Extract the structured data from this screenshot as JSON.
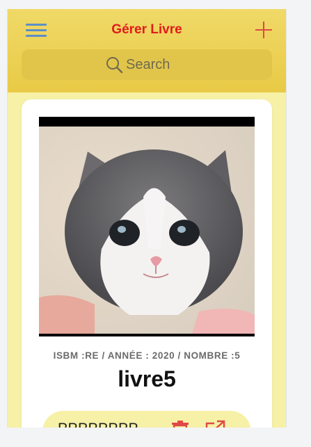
{
  "header": {
    "title": "Gérer Livre",
    "menu_icon": "hamburger-menu-icon",
    "add_icon": "plus-icon",
    "colors": {
      "title": "#e21b1b",
      "menu": "#5b8fc8",
      "add": "#e04848",
      "bar": "#e8ca45"
    }
  },
  "search": {
    "placeholder": "Search",
    "icon": "search-icon"
  },
  "book_card": {
    "image": "kitten-photo",
    "meta": "ISBM :RE / ANNÉE : 2020 / NOMBRE :5",
    "title": "livre5",
    "author": "PPPPPPPP",
    "delete_icon": "trash-icon",
    "open_icon": "external-link-icon",
    "colors": {
      "icons": "#e04848",
      "actions_bg": "#f6f1a6"
    }
  }
}
